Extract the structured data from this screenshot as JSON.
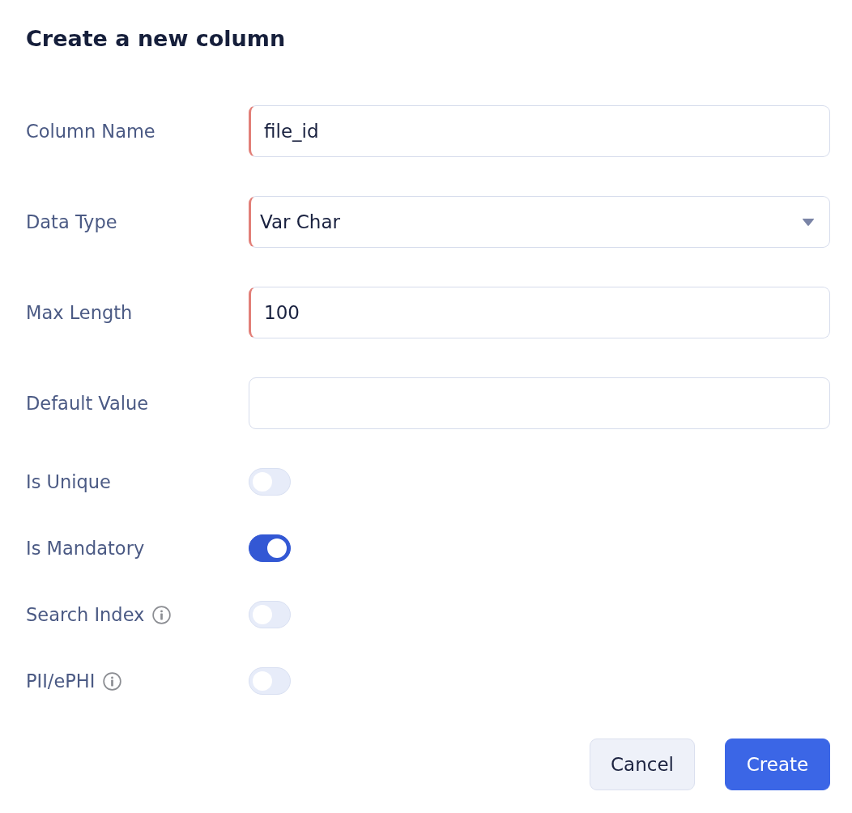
{
  "dialog": {
    "title": "Create a new column"
  },
  "fields": [
    {
      "label": "Column Name",
      "kind": "text",
      "value": "file_id",
      "required": true
    },
    {
      "label": "Data Type",
      "kind": "select",
      "value": "Var Char",
      "required": true
    },
    {
      "label": "Max Length",
      "kind": "text",
      "value": "100",
      "required": true
    },
    {
      "label": "Default Value",
      "kind": "text",
      "required": false
    }
  ],
  "toggles": [
    {
      "label": "Is Unique",
      "on": false,
      "info": false
    },
    {
      "label": "Is Mandatory",
      "on": true,
      "info": false
    },
    {
      "label": "Search Index",
      "on": false,
      "info": true
    },
    {
      "label": "PII/ePHI",
      "on": false,
      "info": true
    }
  ],
  "buttons": [
    {
      "label": "Cancel",
      "kind": "secondary"
    },
    {
      "label": "Create",
      "kind": "primary"
    }
  ]
}
